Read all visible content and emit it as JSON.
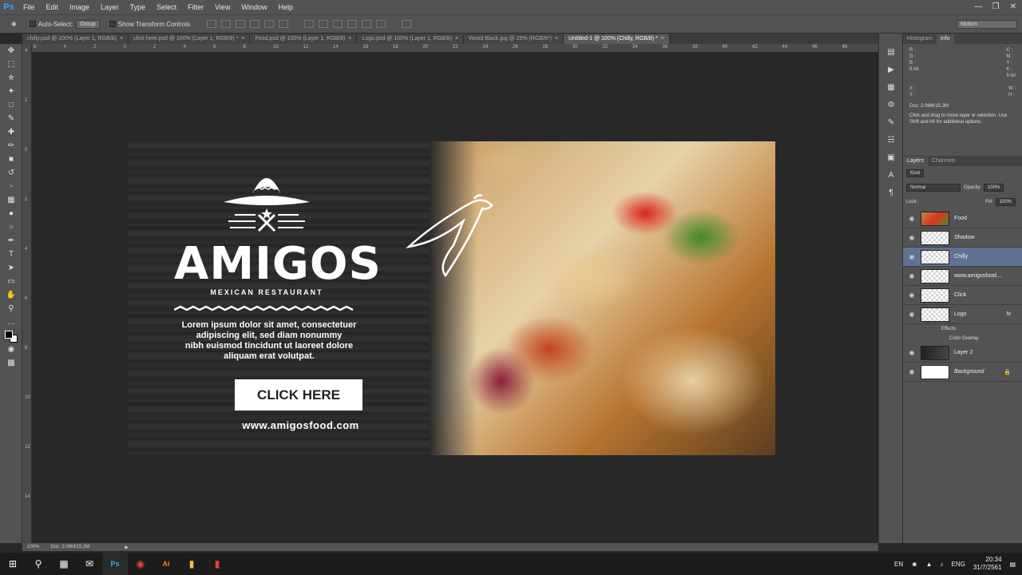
{
  "menubar": {
    "app_icon": "Ps",
    "items": [
      "File",
      "Edit",
      "Image",
      "Layer",
      "Type",
      "Select",
      "Filter",
      "View",
      "Window",
      "Help"
    ],
    "window_controls": [
      "minimize",
      "restore",
      "close"
    ]
  },
  "options_bar": {
    "auto_select_label": "Auto-Select:",
    "auto_select_value": "Group",
    "transform_label": "Show Transform Controls",
    "workspace": "Motion"
  },
  "tabs": [
    {
      "label": "chilly.psd @ 100% (Layer 1, RGB/8)"
    },
    {
      "label": "click here.psd @ 100% (Layer 1, RGB/8) *"
    },
    {
      "label": "Food.psd @ 100% (Layer 1, RGB/8)"
    },
    {
      "label": "Logo.psd @ 100% (Layer 1, RGB/8)"
    },
    {
      "label": "Wood Black.jpg @ 25% (RGB/8*)"
    },
    {
      "label": "Untitled-1 @ 100% (Chilly, RGB/8) *",
      "active": true
    }
  ],
  "ruler_top": [
    "6",
    "4",
    "2",
    "0",
    "2",
    "4",
    "6",
    "8",
    "10",
    "12",
    "14",
    "16",
    "18",
    "20",
    "22",
    "24",
    "26",
    "28",
    "30",
    "32",
    "34",
    "36",
    "38",
    "40",
    "42",
    "44",
    "46",
    "48"
  ],
  "ruler_left": [
    "4",
    "2",
    "0",
    "2",
    "4",
    "6",
    "8",
    "10",
    "12",
    "14"
  ],
  "banner": {
    "logo": "AMIGOS",
    "logo_sub": "MEXICAN RESTAURANT",
    "body": [
      "Lorem ipsum dolor sit amet, consectetuer",
      "adipiscing elit, sed diam nonummy",
      "nibh euismod tincidunt ut laoreet dolore",
      "aliquam erat volutpat."
    ],
    "cta": "CLICK HERE",
    "url": "www.amigosfood.com"
  },
  "info_panel": {
    "tabs": [
      "Histogram",
      "Info"
    ],
    "left_channels": "R :\nG :\nB :",
    "right_channels": "C :\nM :\nY :\nK :",
    "left_bits": "8-bit",
    "right_bits": "8-bit",
    "xy": "X :\nY :",
    "wh": "W :\nH :",
    "doc": "Doc: 2.06M/15.3M",
    "hint": "Click and drag to move layer or selection. Use Shift and Alt for additional options."
  },
  "layers_panel": {
    "tabs": [
      "Layers",
      "Channels"
    ],
    "kind": "Kind",
    "blend": "Normal",
    "opacity_label": "Opacity:",
    "opacity": "100%",
    "lock_label": "Lock:",
    "fill_label": "Fill:",
    "fill": "100%",
    "layers": [
      {
        "name": "Food"
      },
      {
        "name": "Shadow"
      },
      {
        "name": "Chilly",
        "selected": true
      },
      {
        "name": "www.amigosfood...."
      },
      {
        "name": "Click"
      },
      {
        "name": "Logo",
        "fx": "fx"
      },
      {
        "name": "Layer 2"
      },
      {
        "name": "Background"
      }
    ],
    "effects_label": "Effects",
    "effect_name": "Color Overlay"
  },
  "status": {
    "zoom": "100%",
    "doc": "Doc: 2.06M/15.3M"
  },
  "taskbar": {
    "lang": "ENG",
    "input": "EN",
    "time": "20:34",
    "date": "31/7/2561"
  }
}
